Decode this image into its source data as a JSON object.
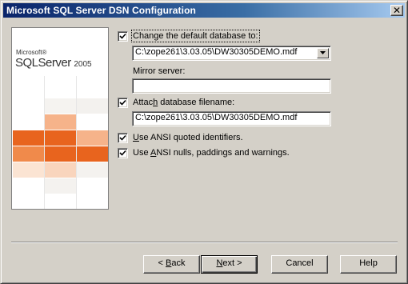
{
  "window": {
    "title": "Microsoft SQL Server DSN Configuration",
    "close_glyph": "✕"
  },
  "logo": {
    "brand": "Microsoft®",
    "product": "SQLServer",
    "year": "2005"
  },
  "form": {
    "change_db": {
      "checked": true,
      "label": "Change the default database to:",
      "value": "C:\\zope261\\3.03.05\\DW30305DEMO.mdf"
    },
    "mirror": {
      "label": "Mirror server:",
      "value": ""
    },
    "attach": {
      "checked": true,
      "label_pre": "Attac",
      "label_u": "h",
      "label_post": " database filename:",
      "value": "C:\\zope261\\3.03.05\\DW30305DEMO.mdf"
    },
    "ansi_quoted": {
      "checked": true,
      "label_u": "U",
      "label_post": "se ANSI quoted identifiers."
    },
    "ansi_nulls": {
      "checked": true,
      "label_pre": "Use ",
      "label_u": "A",
      "label_post": "NSI nulls, paddings and warnings."
    }
  },
  "buttons": {
    "back": {
      "arrow": "< ",
      "u": "B",
      "post": "ack"
    },
    "next": {
      "u": "N",
      "post": "ext >"
    },
    "cancel": "Cancel",
    "help": "Help"
  },
  "colors": {
    "title_bar": "#0a246a",
    "orange": "#e8641e",
    "orange_light": "#f6b38a",
    "dialog_bg": "#d4d0c8"
  }
}
